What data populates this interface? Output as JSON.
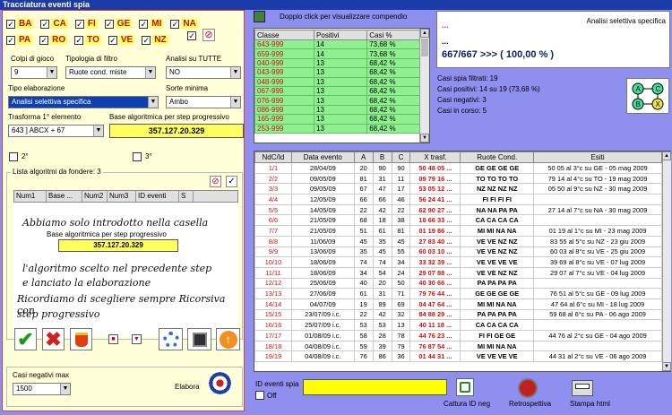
{
  "window": {
    "title": "Tracciatura eventi spia"
  },
  "wheels": {
    "row1": [
      {
        "name": "BA",
        "checked": true
      },
      {
        "name": "CA",
        "checked": true
      },
      {
        "name": "FI",
        "checked": true
      },
      {
        "name": "GE",
        "checked": true
      },
      {
        "name": "MI",
        "checked": true
      },
      {
        "name": "NA",
        "checked": true
      }
    ],
    "row2": [
      {
        "name": "PA",
        "checked": true
      },
      {
        "name": "RO",
        "checked": true
      },
      {
        "name": "TO",
        "checked": true
      },
      {
        "name": "VE",
        "checked": true
      },
      {
        "name": "NZ",
        "checked": true
      }
    ]
  },
  "form": {
    "colpi_label": "Colpi di gioco",
    "colpi_value": "9",
    "tipologia_label": "Tipologia di filtro",
    "tipologia_value": "Ruote cond. miste",
    "analisi_tutte_label": "Analisi su TUTTE",
    "analisi_tutte_value": "NO",
    "tipo_elab_label": "Tipo elaborazione",
    "tipo_elab_value": "Analisi selettiva specifica",
    "sorte_label": "Sorte minima",
    "sorte_value": "Ambo",
    "trasforma_label": "Trasforma 1° elemento",
    "trasforma_value": "643 ] ABCX + 67",
    "base_label": "Base algoritmica per step progressivo",
    "base_value": "357.127.20.329",
    "check2_label": "2°",
    "check3_label": "3°",
    "lista_label": "Lista algoritmi da fondere: 3",
    "lista_cols": [
      "Num1",
      "Base ...",
      "Num2",
      "Num3",
      "ID eventi",
      "S"
    ],
    "casi_neg_label": "Casi negativi max",
    "casi_neg_value": "1500",
    "elabora_label": "Elabora"
  },
  "annotation": {
    "line1": "Abbiamo solo introdotto nella casella",
    "box_label": "Base algoritmica per step progressivo",
    "box_value": "357.127.20.329",
    "line2": "l'algoritmo scelto nel precedente step",
    "line3": "e lanciato la elaborazione",
    "line4": "Ricordiamo di scegliere sempre Ricorsiva con",
    "line5": "step progressivo"
  },
  "compendio": {
    "hint": "Doppio click per visualizzare compendio",
    "cols": [
      "Classe",
      "Positivi",
      "Casi %"
    ],
    "rows": [
      [
        "643-999",
        "14",
        "73,68 %"
      ],
      [
        "659-999",
        "14",
        "73,68 %"
      ],
      [
        "040-999",
        "13",
        "68,42 %"
      ],
      [
        "043-999",
        "13",
        "68,42 %"
      ],
      [
        "048-999",
        "13",
        "68,42 %"
      ],
      [
        "067-999",
        "13",
        "68,42 %"
      ],
      [
        "076-999",
        "13",
        "68,42 %"
      ],
      [
        "086-999",
        "13",
        "68,42 %"
      ],
      [
        "165-999",
        "13",
        "68,42 %"
      ],
      [
        "253-999",
        "13",
        "68,42 %"
      ]
    ]
  },
  "summary": {
    "dots1": "...",
    "mode": "Analisi selettiva specifica",
    "dots2": "...",
    "result": "667/667 >>> ( 100,00 % )",
    "filtrati": "Casi spia filtrati: 19",
    "positivi": "Casi positivi: 14 su 19 (73,68 %)",
    "negativi": "Casi negativi: 3",
    "in_corso": "Casi in corso: 5"
  },
  "diagram": {
    "nodes": [
      "A",
      "C",
      "B",
      "X"
    ]
  },
  "results": {
    "cols": [
      "NdC/Id",
      "Data evento",
      "A",
      "B",
      "C",
      "X trasf.",
      "Ruote Cond.",
      "Esiti"
    ],
    "rows": [
      [
        "1/1",
        "28/04/09",
        "20",
        "90",
        "90",
        "50 48 05 ...",
        "GE GE GE GE",
        "50 05 al 3°c su GE - 05 mag 2009"
      ],
      [
        "2/2",
        "09/05/09",
        "81",
        "31",
        "11",
        "09 79 16 ...",
        "TO TO TO TO",
        "79 14 al 4°c su TO - 19 mag 2009"
      ],
      [
        "3/3",
        "09/05/09",
        "67",
        "47",
        "17",
        "53 05 12 ...",
        "NZ NZ NZ NZ",
        "05 50 al 9°c su NZ - 30 mag 2009"
      ],
      [
        "4/4",
        "12/05/09",
        "66",
        "66",
        "46",
        "56 24 41 ...",
        "FI FI FI FI",
        ""
      ],
      [
        "5/5",
        "14/05/09",
        "22",
        "42",
        "22",
        "62 90 27 ...",
        "NA NA PA PA",
        "27 14 al 7°c su NA - 30 mag 2009"
      ],
      [
        "6/6",
        "21/05/09",
        "68",
        "18",
        "38",
        "18 66 33 ...",
        "CA CA CA CA",
        ""
      ],
      [
        "7/7",
        "21/05/09",
        "51",
        "61",
        "81",
        "01 19 86 ...",
        "MI MI NA NA",
        "01 19 al 1°c su MI - 23 mag 2009"
      ],
      [
        "8/8",
        "11/06/09",
        "45",
        "35",
        "45",
        "27 83 40 ...",
        "VE VE NZ NZ",
        "83 55 al 5°c su NZ - 23 giu 2009"
      ],
      [
        "9/9",
        "13/06/09",
        "35",
        "45",
        "55",
        "60 03 10 ...",
        "VE VE NZ NZ",
        "60 03 al 8°c su VE - 25 giu 2009"
      ],
      [
        "10/10",
        "18/06/09",
        "74",
        "74",
        "34",
        "33 32 39 ...",
        "VE VE VE VE",
        "39 69 al 8°c su VE - 07 lug 2009"
      ],
      [
        "11/11",
        "18/06/09",
        "34",
        "54",
        "24",
        "29 07 88 ...",
        "VE VE NZ NZ",
        "29 07 al 7°c su VE - 04 lug 2009"
      ],
      [
        "12/12",
        "25/06/09",
        "40",
        "20",
        "50",
        "40 30 66 ...",
        "PA PA PA PA",
        ""
      ],
      [
        "13/13",
        "27/06/09",
        "61",
        "31",
        "71",
        "79 76 44 ...",
        "GE GE GE GE",
        "76 51 al 5°c su GE - 09 lug 2009"
      ],
      [
        "14/14",
        "04/07/09",
        "19",
        "89",
        "69",
        "04 47 64 ...",
        "MI MI NA NA",
        "47 64 al 6°c su MI - 18 lug 2009"
      ],
      [
        "15/15",
        "23/07/09 i.c.",
        "22",
        "42",
        "32",
        "84 88 29 ...",
        "PA PA PA PA",
        "59 68 al 6°c su PA - 06 ago 2009"
      ],
      [
        "16/16",
        "25/07/09 i.c.",
        "53",
        "53",
        "13",
        "40 11 18 ...",
        "CA CA CA CA",
        ""
      ],
      [
        "17/17",
        "01/08/09 i.c.",
        "58",
        "28",
        "78",
        "44 76 23 ...",
        "FI FI GE GE",
        "44 76 al 2°c su GE - 04 ago 2009"
      ],
      [
        "18/18",
        "04/08/09 i.c.",
        "59",
        "39",
        "79",
        "76 87 54 ...",
        "MI MI NA NA",
        ""
      ],
      [
        "19/19",
        "04/08/09 i.c.",
        "76",
        "86",
        "36",
        "01 44 31 ...",
        "VE VE VE VE",
        "44 31 al 2°c su VE - 06 ago 2009"
      ]
    ]
  },
  "bottom": {
    "id_label": "ID eventi spia",
    "off_label": "Off",
    "cattura": "Cattura ID neg",
    "retro": "Retrospettiva",
    "stampa": "Stampa html"
  }
}
